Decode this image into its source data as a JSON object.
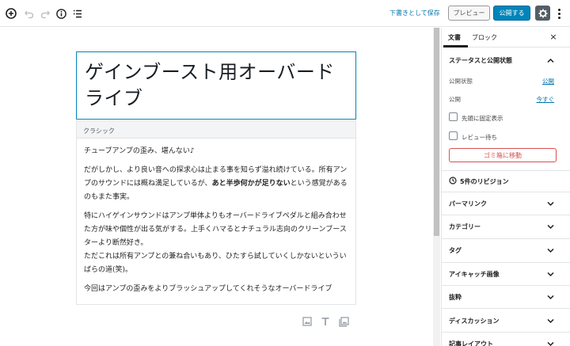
{
  "toolbar": {
    "save_draft": "下書きとして保存",
    "preview": "プレビュー",
    "publish": "公開する"
  },
  "editor": {
    "title": "ゲインブースト用オーバードライブ",
    "classic_label": "クラシック",
    "paragraphs": [
      "チューブアンプの歪み、堪んない♪",
      "だがしかし、より良い音への探求心は止まる事を知らず溢れ続けている。所有アンプのサウンドには概ね満足しているが、",
      "あと半歩何かが足りない",
      "という感覚があるのもまた事実。",
      "特にハイゲインサウンドはアンプ単体よりもオーバードライブペダルと組み合わせた方が味や個性が出る気がする。上手くハマるとナチュラル志向のクリーンブースターより断然好き。",
      "ただこれは所有アンプとの兼ね合いもあり、ひたすら試していくしかないといういばらの道(笑)。",
      "今回はアンプの歪みをよりブラッシュアップしてくれそうなオーバードライブ"
    ]
  },
  "sidebar": {
    "tab_document": "文書",
    "tab_block": "ブロック",
    "close": "×",
    "status_title": "ステータスと公開状態",
    "visibility_label": "公開状態",
    "visibility_value": "公開",
    "publish_label": "公開",
    "publish_value": "今すぐ",
    "sticky_label": "先頭に固定表示",
    "pending_label": "レビュー待ち",
    "trash": "ゴミ箱に移動",
    "revisions": "5件のリビジョン",
    "panels": [
      "パーマリンク",
      "カテゴリー",
      "タグ",
      "アイキャッチ画像",
      "抜粋",
      "ディスカッション",
      "記事レイアウト"
    ]
  },
  "colors": {
    "primary": "#0085ba",
    "link": "#0073aa",
    "danger": "#d94f4f",
    "settings_bg": "#555d66"
  }
}
